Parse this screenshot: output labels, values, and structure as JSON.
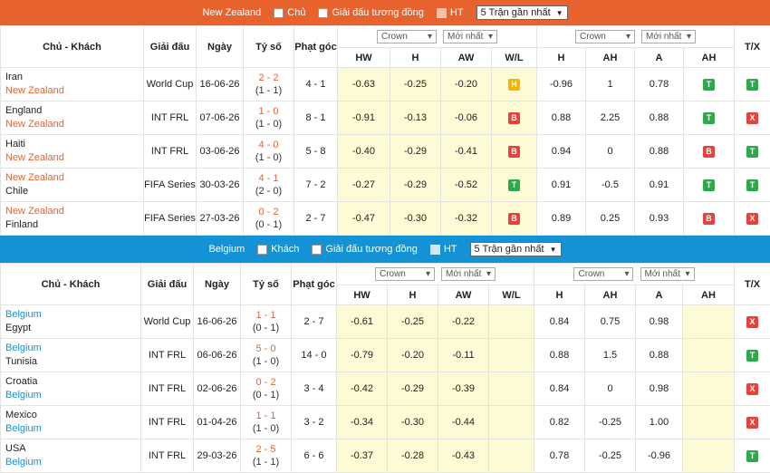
{
  "top": {
    "bar": {
      "team": "New Zealand",
      "opt1": "Chủ",
      "opt2": "Giải đấu tương đồng",
      "opt3": "HT",
      "select": "5 Trận gần nhất"
    },
    "headers": {
      "teams": "Chủ - Khách",
      "league": "Giải đấu",
      "date": "Ngày",
      "score": "Tỷ số",
      "corner": "Phạt góc",
      "crown": "Crown",
      "latest": "Mới nhất",
      "hw": "HW",
      "h": "H",
      "aw": "AW",
      "wl": "W/L",
      "h2": "H",
      "ah": "AH",
      "a": "A",
      "ah2": "AH",
      "tx": "T/X"
    },
    "rows": [
      {
        "t1": "Iran",
        "t2": "New Zealand",
        "league": "World Cup",
        "date": "16-06-26",
        "score": "2 - 2",
        "ht": "(1 - 1)",
        "corner": "4 - 1",
        "hw": "-0.63",
        "h": "-0.25",
        "aw": "-0.20",
        "wl": "H",
        "h2": "-0.96",
        "ah": "1",
        "a": "0.78",
        "ahr": "T",
        "tx": "T"
      },
      {
        "t1": "England",
        "t2": "New Zealand",
        "league": "INT FRL",
        "date": "07-06-26",
        "score": "1 - 0",
        "ht": "(1 - 0)",
        "corner": "8 - 1",
        "hw": "-0.91",
        "h": "-0.13",
        "aw": "-0.06",
        "wl": "B",
        "h2": "0.88",
        "ah": "2.25",
        "a": "0.88",
        "ahr": "T",
        "tx": "X"
      },
      {
        "t1": "Haiti",
        "t2": "New Zealand",
        "league": "INT FRL",
        "date": "03-06-26",
        "score": "4 - 0",
        "ht": "(1 - 0)",
        "corner": "5 - 8",
        "hw": "-0.40",
        "h": "-0.29",
        "aw": "-0.41",
        "wl": "B",
        "h2": "0.94",
        "ah": "0",
        "a": "0.88",
        "ahr": "B",
        "tx": "T"
      },
      {
        "t1": "New Zealand",
        "t2": "Chile",
        "league": "FIFA Series",
        "date": "30-03-26",
        "score": "4 - 1",
        "ht": "(2 - 0)",
        "corner": "7 - 2",
        "hw": "-0.27",
        "h": "-0.29",
        "aw": "-0.52",
        "wl": "T",
        "h2": "0.91",
        "ah": "-0.5",
        "a": "0.91",
        "ahr": "T",
        "tx": "T"
      },
      {
        "t1": "New Zealand",
        "t2": "Finland",
        "league": "FIFA Series",
        "date": "27-03-26",
        "score": "0 - 2",
        "ht": "(0 - 1)",
        "corner": "2 - 7",
        "hw": "-0.47",
        "h": "-0.30",
        "aw": "-0.32",
        "wl": "B",
        "h2": "0.89",
        "ah": "0.25",
        "a": "0.93",
        "ahr": "B",
        "tx": "X"
      }
    ]
  },
  "bottom": {
    "bar": {
      "team": "Belgium",
      "opt1": "Khách",
      "opt2": "Giải đấu tương đồng",
      "opt3": "HT",
      "select": "5 Trận gần nhất"
    },
    "rows": [
      {
        "t1": "Belgium",
        "t2": "Egypt",
        "league": "World Cup",
        "date": "16-06-26",
        "score": "1 - 1",
        "ht": "(0 - 1)",
        "corner": "2 - 7",
        "hw": "-0.61",
        "h": "-0.25",
        "aw": "-0.22",
        "h2": "0.84",
        "ah": "0.75",
        "a": "0.98",
        "tx": "X"
      },
      {
        "t1": "Belgium",
        "t2": "Tunisia",
        "league": "INT FRL",
        "date": "06-06-26",
        "score": "5 - 0",
        "ht": "(1 - 0)",
        "corner": "14 - 0",
        "hw": "-0.79",
        "h": "-0.20",
        "aw": "-0.11",
        "h2": "0.88",
        "ah": "1.5",
        "a": "0.88",
        "tx": "T"
      },
      {
        "t1": "Croatia",
        "t2": "Belgium",
        "league": "INT FRL",
        "date": "02-06-26",
        "score": "0 - 2",
        "ht": "(0 - 1)",
        "corner": "3 - 4",
        "hw": "-0.42",
        "h": "-0.29",
        "aw": "-0.39",
        "h2": "0.84",
        "ah": "0",
        "a": "0.98",
        "tx": "X"
      },
      {
        "t1": "Mexico",
        "t2": "Belgium",
        "league": "INT FRL",
        "date": "01-04-26",
        "score": "1 - 1",
        "ht": "(1 - 0)",
        "corner": "3 - 2",
        "hw": "-0.34",
        "h": "-0.30",
        "aw": "-0.44",
        "h2": "0.82",
        "ah": "-0.25",
        "a": "1.00",
        "tx": "X"
      },
      {
        "t1": "USA",
        "t2": "Belgium",
        "league": "INT FRL",
        "date": "29-03-26",
        "score": "2 - 5",
        "ht": "(1 - 1)",
        "corner": "6 - 6",
        "hw": "-0.37",
        "h": "-0.28",
        "aw": "-0.43",
        "h2": "0.78",
        "ah": "-0.25",
        "a": "-0.96",
        "tx": "T"
      }
    ]
  }
}
